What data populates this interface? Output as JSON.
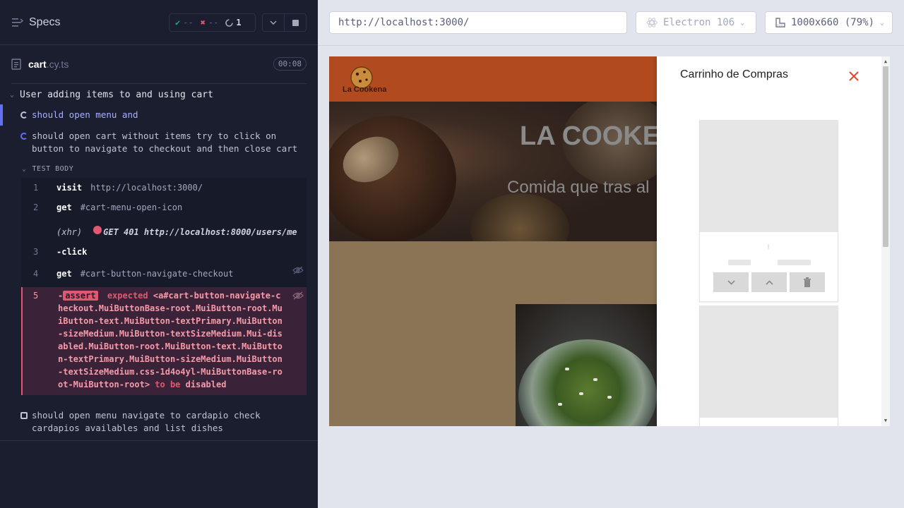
{
  "reporter": {
    "header": {
      "title": "Specs"
    },
    "stats": {
      "passed": "--",
      "failed": "--",
      "pending": "1"
    },
    "file": {
      "name": "cart",
      "ext": ".cy.ts",
      "duration": "00:08"
    },
    "suite": {
      "title": "User adding items to and using cart",
      "tests": [
        {
          "title": "should open menu and",
          "state": "running"
        },
        {
          "title": "should open cart without items try to click on button to navigate to checkout and then close cart",
          "state": "active"
        },
        {
          "title": "should open menu navigate to cardapio check cardapios availables and list dishes",
          "state": "pending"
        }
      ],
      "body_label": "TEST BODY",
      "commands": [
        {
          "num": "1",
          "name": "visit",
          "msg": "http://localhost:3000/"
        },
        {
          "num": "2",
          "name": "get",
          "msg": "#cart-menu-open-icon"
        },
        {
          "xhr_label": "(xhr)",
          "xhr_msg": "GET 401 http://localhost:8000/users/me"
        },
        {
          "num": "3",
          "name": "-click",
          "msg": ""
        },
        {
          "num": "4",
          "name": "get",
          "msg": "#cart-button-navigate-checkout"
        },
        {
          "num": "5",
          "prefix": "-",
          "name": "assert",
          "expected_word": "expected",
          "target": "<a#cart-button-navigate-checkout.MuiButtonBase-root.MuiButton-root.MuiButton-text.MuiButton-textPrimary.MuiButton-sizeMedium.MuiButton-textSizeMedium.Mui-disabled.MuiButton-root.MuiButton-text.MuiButton-textPrimary.MuiButton-sizeMedium.MuiButton-textSizeMedium.css-1d4o4yl-MuiButtonBase-root-MuiButton-root>",
          "to_be": "to be",
          "state": "disabled"
        }
      ]
    }
  },
  "toolbar": {
    "url": "http://localhost:3000/",
    "browser": "Electron 106",
    "viewport": "1000x660 (79%)"
  },
  "aut": {
    "logo_text": "La Cookena",
    "hero_title": "LA COOKER",
    "hero_sub": "Comida que tras al",
    "drawer_title": "Carrinho de Compras"
  },
  "colors": {
    "reporter_bg": "#1b1e2e",
    "pass": "#1fa971",
    "fail": "#e45770",
    "accent": "#6470f3",
    "header_brand": "#b24a20",
    "close_icon": "#e04a2a"
  },
  "icons": {
    "menu": "menu-icon",
    "check": "check-icon",
    "cross": "x-icon",
    "spinner": "spinner-icon",
    "chevron": "chevron-down-icon",
    "stop": "stop-icon",
    "file": "document-icon",
    "hide": "eye-slash-icon",
    "browser": "electron-icon",
    "viewport": "ruler-icon",
    "close": "close-icon",
    "trash": "trash-icon"
  }
}
